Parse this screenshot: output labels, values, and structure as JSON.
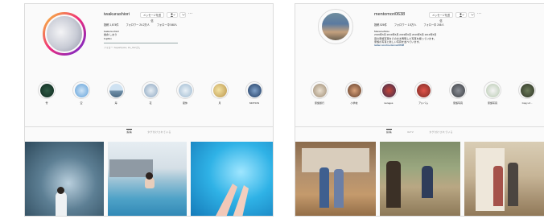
{
  "left": {
    "username": "iwakurashiori",
    "buttons": {
      "message": "メッセージを送信",
      "follow_icon": "person-check-icon",
      "dropdown_icon": "chevron-down-icon"
    },
    "more": "···",
    "stats": [
      "投稿 1,674件",
      "フォロワー 24.2万人",
      "フォロー中 548人"
    ],
    "bio": [
      "iwakura shiori",
      "岩倉 しおり",
      "Fujifilm"
    ],
    "bio_link": "",
    "followed_by": "フォロー: hayashiyoku, iris_012さん",
    "highlights": [
      "雪",
      "空",
      "海",
      "花",
      "夏休",
      "月",
      "MOTION"
    ],
    "tabs": [
      "投稿",
      "タグ付けされている"
    ],
    "posts": [
      {
        "icon": "photo-girl-in-snow"
      },
      {
        "icon": "photo-girl-in-pool"
      },
      {
        "icon": "photo-feet-in-water"
      }
    ]
  },
  "right": {
    "username": "mentomori0638",
    "buttons": {
      "message": "メッセージを送信",
      "follow_icon": "person-check-icon",
      "dropdown_icon": "chevron-down-icon"
    },
    "more": "···",
    "stats": [
      "投稿 526件",
      "フォロワー 1.5万人",
      "フォロー中 246人"
    ],
    "bio": [
      "ManamoMoto",
      "2019年6月 2019年6月 2019年6月 2019年6月 2019年6月",
      "昔の家族写真をそのまま再現した写真を撮っています。",
      "家族の写真と新しい写真を並べています。"
    ],
    "bio_link": "twitter.com/mentomori0638",
    "followed_by": "",
    "highlights": [
      "家族旅行",
      "小学校",
      "kurogos",
      "アルバム",
      "家族写真",
      "家族写真",
      "Copy of..."
    ],
    "tabs": [
      "投稿",
      "IGTV",
      "タグ付けされている"
    ],
    "posts": [
      {
        "icon": "photo-couple-at-house"
      },
      {
        "icon": "photo-family-outdoors"
      },
      {
        "icon": "photo-family-in-room"
      }
    ]
  },
  "colors": {
    "link": "#00376b",
    "muted": "#8e8e8e",
    "border": "#dbdbdb",
    "text": "#262626"
  }
}
